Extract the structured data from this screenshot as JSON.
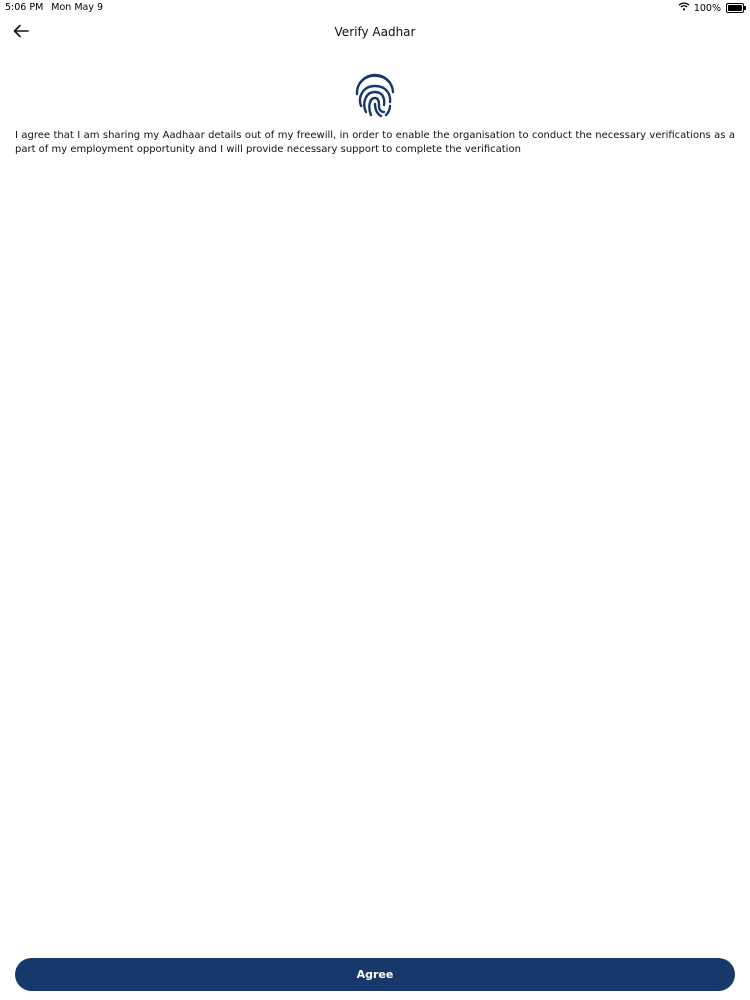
{
  "status_bar": {
    "time": "5:06 PM",
    "date": "Mon May 9",
    "battery": "100%"
  },
  "header": {
    "title": "Verify Aadhar",
    "back_icon": "arrow-left-icon"
  },
  "main": {
    "icon": "fingerprint-icon",
    "consent_text": "I agree that I am sharing my Aadhaar details out of my freewill, in order to enable the organisation to conduct the necessary verifications as a part of my employment opportunity and I will provide necessary support to complete the verification"
  },
  "footer": {
    "agree_label": "Agree"
  },
  "colors": {
    "primary": "#17386b",
    "text": "#111111",
    "background": "#ffffff"
  }
}
